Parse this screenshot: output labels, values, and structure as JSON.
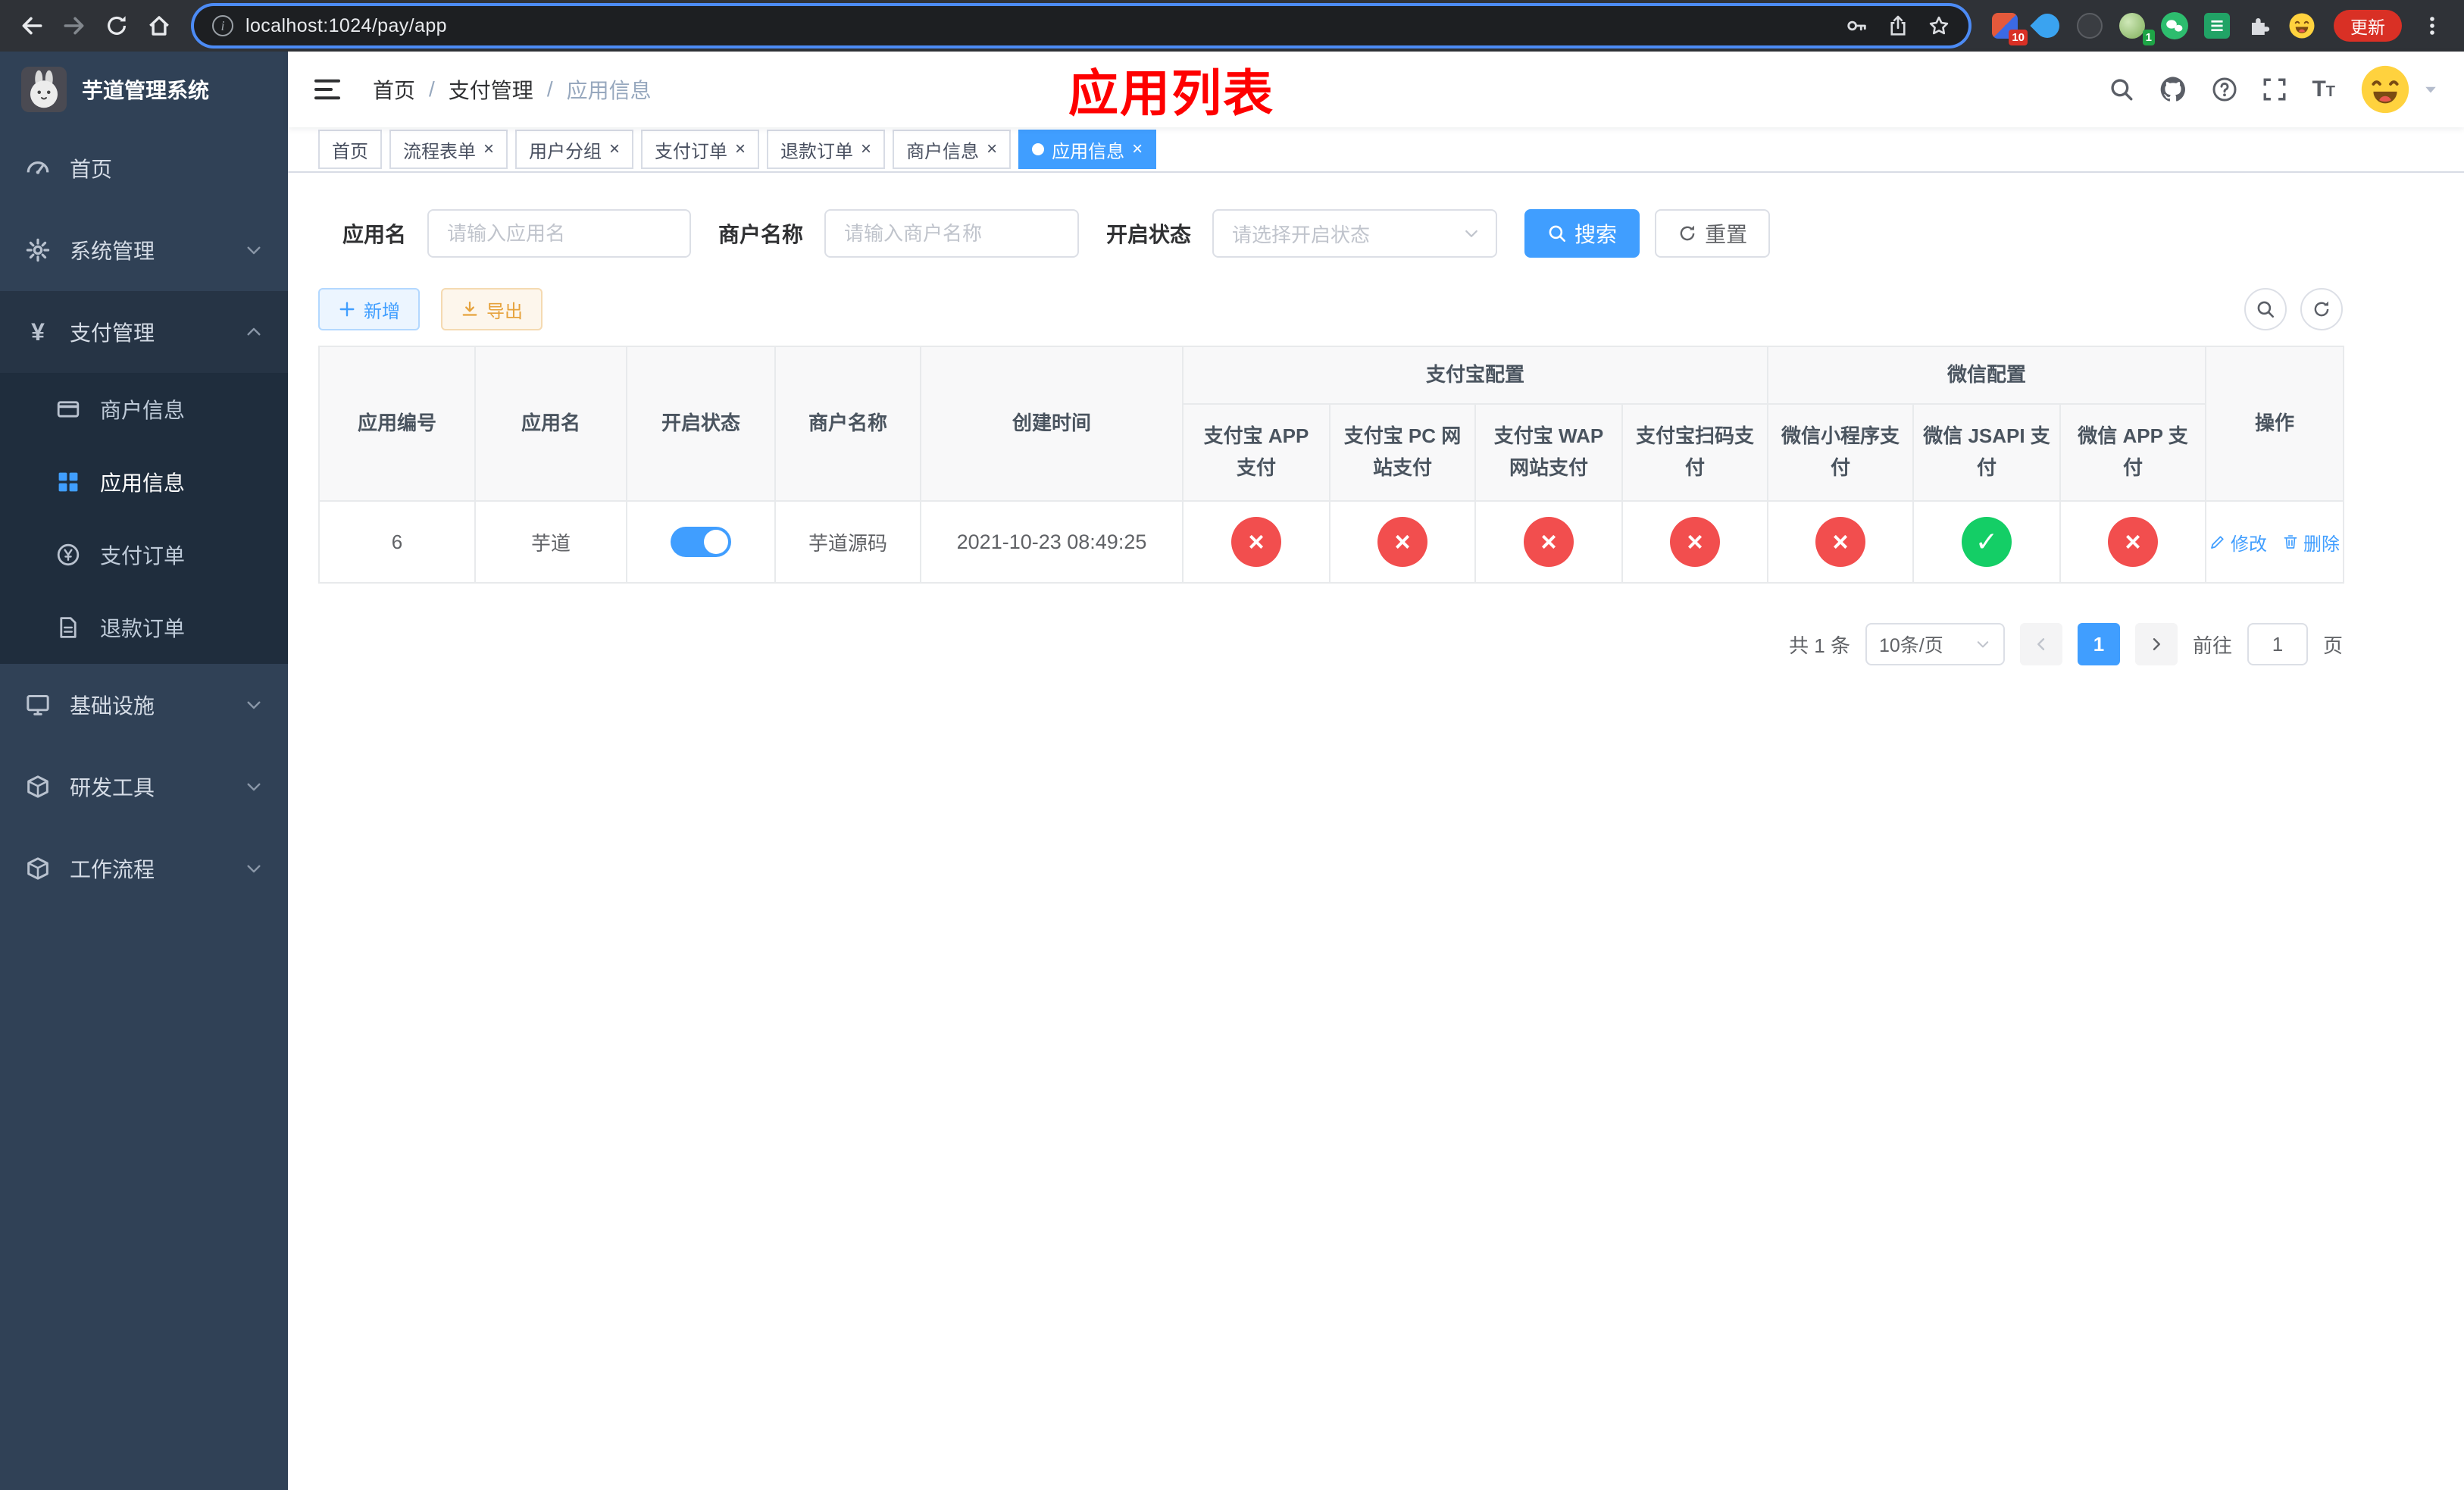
{
  "browser": {
    "url": "localhost:1024/pay/app",
    "update_label": "更新",
    "ext_badge_red": "10",
    "ext_badge_green": "1"
  },
  "sidebar": {
    "title": "芋道管理系统",
    "home": "首页",
    "system": "系统管理",
    "payment": "支付管理",
    "payment_children": [
      "商户信息",
      "应用信息",
      "支付订单",
      "退款订单"
    ],
    "infra": "基础设施",
    "devtool": "研发工具",
    "workflow": "工作流程"
  },
  "header": {
    "breadcrumb": [
      "首页",
      "支付管理",
      "应用信息"
    ],
    "overlay_title": "应用列表"
  },
  "tabs": [
    {
      "label": "首页"
    },
    {
      "label": "流程表单"
    },
    {
      "label": "用户分组"
    },
    {
      "label": "支付订单"
    },
    {
      "label": "退款订单"
    },
    {
      "label": "商户信息"
    },
    {
      "label": "应用信息"
    }
  ],
  "filters": {
    "app_name_label": "应用名",
    "app_name_placeholder": "请输入应用名",
    "merchant_label": "商户名称",
    "merchant_placeholder": "请输入商户名称",
    "status_label": "开启状态",
    "status_placeholder": "请选择开启状态",
    "search_label": "搜索",
    "reset_label": "重置"
  },
  "toolbar": {
    "add_label": "新增",
    "export_label": "导出"
  },
  "table": {
    "group_alipay": "支付宝配置",
    "group_wechat": "微信配置",
    "col_id": "应用编号",
    "col_name": "应用名",
    "col_status": "开启状态",
    "col_merchant": "商户名称",
    "col_created": "创建时间",
    "col_alipay_app": "支付宝 APP 支付",
    "col_alipay_pc": "支付宝 PC 网站支付",
    "col_alipay_wap": "支付宝 WAP 网站支付",
    "col_alipay_qr": "支付宝扫码支付",
    "col_wx_mini": "微信小程序支付",
    "col_wx_jsapi": "微信 JSAPI 支付",
    "col_wx_app": "微信 APP 支付",
    "col_actions": "操作",
    "rows": [
      {
        "id": "6",
        "name": "芋道",
        "status_on": true,
        "merchant": "芋道源码",
        "created": "2021-10-23 08:49:25",
        "configs": [
          "no",
          "no",
          "no",
          "no",
          "no",
          "yes",
          "no"
        ],
        "edit_label": "修改",
        "delete_label": "删除"
      }
    ]
  },
  "pagination": {
    "total": "共 1 条",
    "page_size": "10条/页",
    "page": "1",
    "goto_prefix": "前往",
    "goto_value": "1",
    "goto_suffix": "页"
  },
  "icons": {
    "check": "✓",
    "close": "×"
  },
  "colors": {
    "primary": "#409eff",
    "danger": "#f24e4e",
    "success": "#14ce66",
    "annotation": "#fe0000"
  }
}
